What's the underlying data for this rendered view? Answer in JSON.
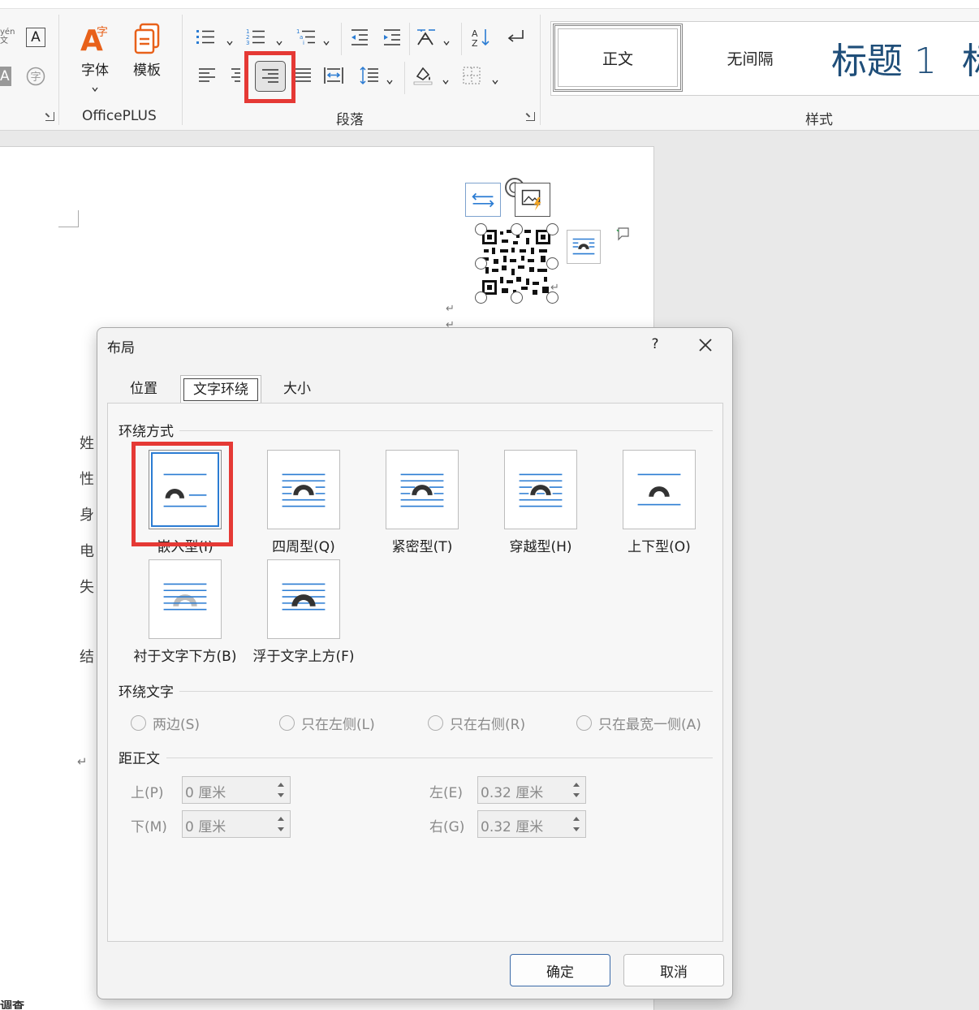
{
  "ribbon": {
    "font_group": {
      "phonetic_fragment": "yén",
      "phonetic_fragment2": "文",
      "a_label": "A"
    },
    "officeplus": {
      "font_label": "字体",
      "template_label": "模板",
      "group_label": "OfficePLUS"
    },
    "paragraph": {
      "group_label": "段落"
    },
    "styles": {
      "group_label": "样式",
      "items": [
        {
          "label": "正文"
        },
        {
          "label": "无间隔"
        },
        {
          "label": "标题 1"
        },
        {
          "label": "标"
        }
      ]
    }
  },
  "document": {
    "side_chars": [
      "姓",
      "性",
      "身",
      "电",
      "失",
      "结"
    ],
    "bottom_text": "调查",
    "para_mark": "↵"
  },
  "dialog": {
    "title": "布局",
    "help": "?",
    "tabs": [
      {
        "label": "位置"
      },
      {
        "label": "文字环绕"
      },
      {
        "label": "大小"
      }
    ],
    "wrap_section": {
      "title": "环绕方式",
      "options": [
        {
          "label": "嵌入型(I)"
        },
        {
          "label": "四周型(Q)"
        },
        {
          "label": "紧密型(T)"
        },
        {
          "label": "穿越型(H)"
        },
        {
          "label": "上下型(O)"
        },
        {
          "label": "衬于文字下方(B)"
        },
        {
          "label": "浮于文字上方(F)"
        }
      ]
    },
    "wrap_text_section": {
      "title": "环绕文字",
      "options": [
        {
          "label": "两边(S)"
        },
        {
          "label": "只在左侧(L)"
        },
        {
          "label": "只在右侧(R)"
        },
        {
          "label": "只在最宽一侧(A)"
        }
      ]
    },
    "distance_section": {
      "title": "距正文",
      "top": {
        "label": "上(P)",
        "value": "0 厘米"
      },
      "bottom": {
        "label": "下(M)",
        "value": "0 厘米"
      },
      "left": {
        "label": "左(E)",
        "value": "0.32 厘米"
      },
      "right": {
        "label": "右(G)",
        "value": "0.32 厘米"
      }
    },
    "ok": "确定",
    "cancel": "取消"
  },
  "colors": {
    "accent_blue": "#2b7cd3",
    "highlight_red": "#e53935",
    "office_orange": "#e8611a"
  }
}
